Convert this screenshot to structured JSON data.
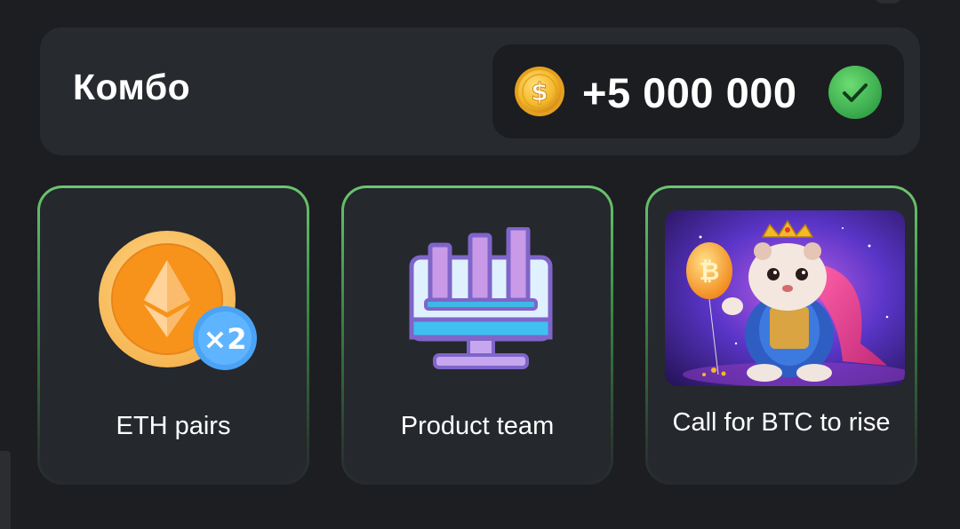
{
  "combo": {
    "title": "Комбо",
    "reward": "+5 000 000",
    "coin_icon": "dollar-coin-icon",
    "status_icon": "checkmark-circle-icon",
    "status_color": "#3fb653"
  },
  "cards": [
    {
      "label": "ETH pairs",
      "icon": "ethereum-x2-icon"
    },
    {
      "label": "Product team",
      "icon": "monitor-chart-icon"
    },
    {
      "label": "Call for BTC to rise",
      "icon": "hamster-bitcoin-balloon-image"
    }
  ],
  "colors": {
    "background": "#1c1e22",
    "panel": "#272a2f",
    "card_border": "#6cc66f",
    "coin": "#f4b82a",
    "eth": "#f7931a"
  }
}
